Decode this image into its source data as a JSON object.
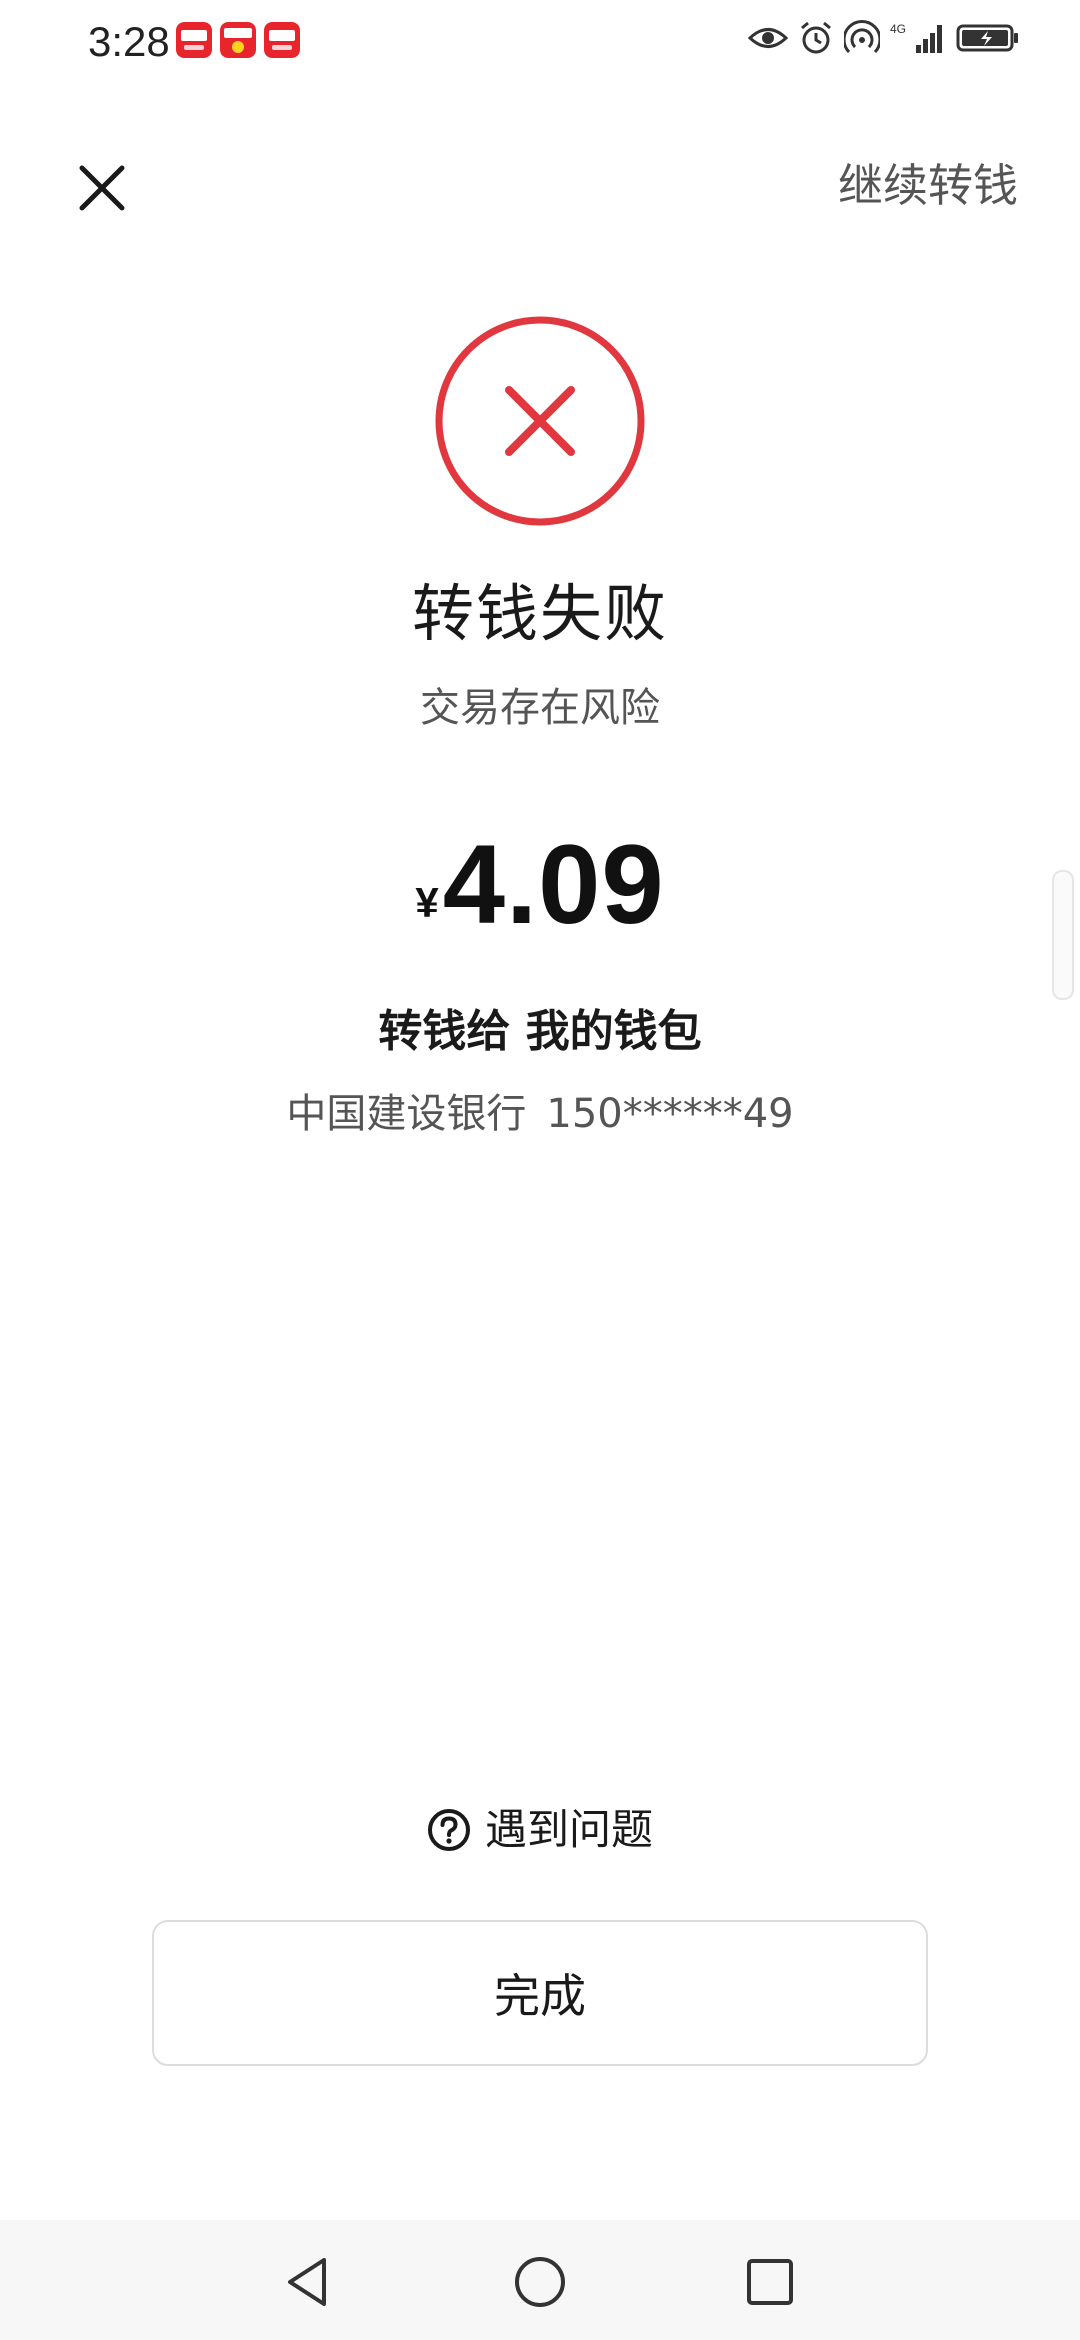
{
  "status_bar": {
    "time": "3:28",
    "notification_icons": [
      "app-notification-icon",
      "app-notification-icon",
      "app-notification-icon"
    ],
    "system_icons": [
      "eye-icon",
      "alarm-icon",
      "hotspot-icon",
      "signal-icon",
      "battery-icon"
    ],
    "network_label": "4G"
  },
  "header": {
    "continue_label": "继续转钱"
  },
  "result": {
    "title": "转钱失败",
    "subtitle": "交易存在风险",
    "status_color": "#e0383e"
  },
  "amount": {
    "currency": "¥",
    "value": "4.09"
  },
  "recipient": {
    "label": "转钱给 我的钱包",
    "bank": "中国建设银行",
    "account": "150******49"
  },
  "help": {
    "label": "遇到问题"
  },
  "actions": {
    "done_label": "完成"
  }
}
